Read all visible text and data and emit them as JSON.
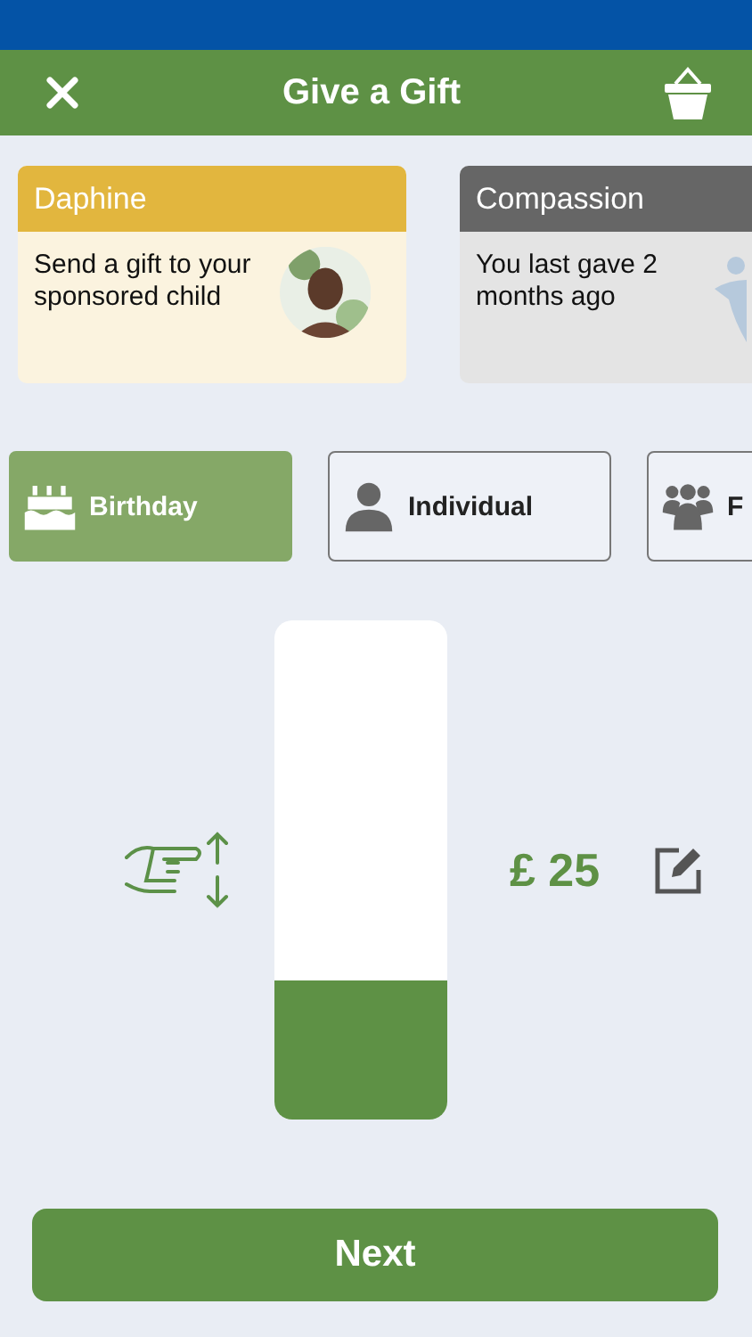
{
  "header": {
    "title": "Give a Gift"
  },
  "cards": [
    {
      "kind": "child",
      "title": "Daphine",
      "text": "Send a gift to your sponsored child",
      "color": "#e2b63e"
    },
    {
      "kind": "ministry",
      "title": "Compassion",
      "text": "You last gave 2 months ago",
      "color": "#666666"
    }
  ],
  "gift_types": [
    {
      "kind": "cake",
      "label": "Birthday",
      "selected": true
    },
    {
      "kind": "person",
      "label": "Individual",
      "selected": false
    },
    {
      "kind": "group",
      "label": "F",
      "selected": false
    }
  ],
  "amount": {
    "level": 0.28,
    "reading": "£ 25"
  },
  "next_button": "Next"
}
